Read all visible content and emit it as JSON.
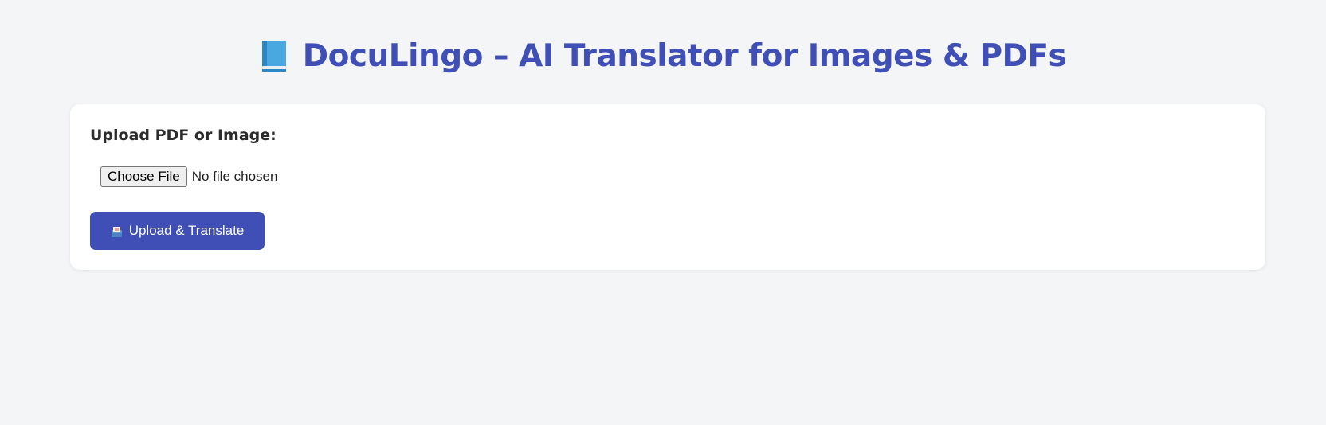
{
  "header": {
    "title": "DocuLingo – AI Translator for Images & PDFs",
    "icon": "blue-book-icon"
  },
  "upload_card": {
    "label": "Upload PDF or Image:",
    "file_input": {
      "button_label": "Choose File",
      "status_text": "No file chosen"
    },
    "submit_button": {
      "label": "Upload & Translate",
      "icon": "inbox-tray-icon"
    }
  },
  "colors": {
    "accent": "#3f4fb5",
    "background": "#f4f5f7",
    "card": "#ffffff"
  }
}
